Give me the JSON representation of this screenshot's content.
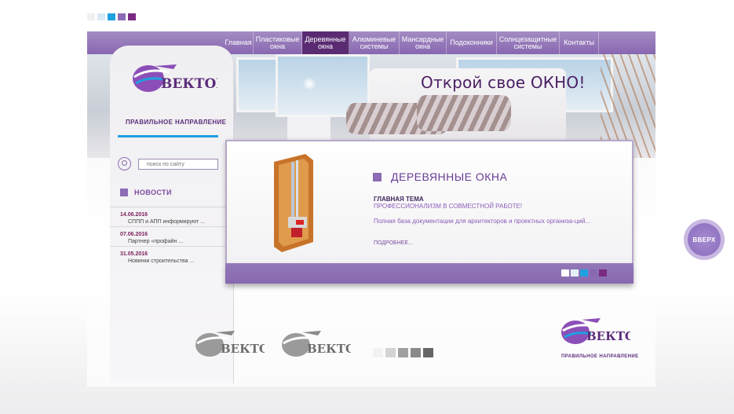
{
  "top_swatches": [
    "#f0f0f2",
    "#d8eaf6",
    "#1fa0e0",
    "#8c6cb4",
    "#7a2a80"
  ],
  "nav": {
    "items": [
      {
        "label": "Главная",
        "active": false,
        "width": 38
      },
      {
        "label": "Пластиковые\nокна",
        "active": false,
        "width": 62
      },
      {
        "label": "Деревянные\nокна",
        "active": true,
        "width": 60
      },
      {
        "label": "Алюминевые\nсистемы",
        "active": false,
        "width": 64
      },
      {
        "label": "Мансардные\nокна",
        "active": false,
        "width": 60
      },
      {
        "label": "Подоконники",
        "active": false,
        "width": 64
      },
      {
        "label": "Солнцезащитные\nсистемы",
        "active": false,
        "width": 80
      },
      {
        "label": "Контакты",
        "active": false,
        "width": 50
      }
    ]
  },
  "hero": {
    "slogan": "Открой свое ОКНО!"
  },
  "brand": {
    "name": "ВЕКТОР",
    "slogan": "ПРАВИЛЬНОЕ НАПРАВЛЕНИЕ"
  },
  "search": {
    "placeholder": "поиск по сайту"
  },
  "news": {
    "title": "НОВОСТИ",
    "items": [
      {
        "date": "14.06.2016",
        "text": "СППП и АПП информируют ..."
      },
      {
        "date": "07.06.2016",
        "text": "Партнер «профайн ..."
      },
      {
        "date": "31.05.2016",
        "text": "Новинки строительства ..."
      }
    ]
  },
  "panel": {
    "title": "ДЕРЕВЯННЫЕ ОКНА",
    "subtitle": "ГЛАВНАЯ ТЕМА",
    "subtitle2": "ПРОФЕССИОНАЛИЗМ В СОВМЕСТНОЙ РАБОТЕ!",
    "description": "Полная база документации для архитекторов и проектных организа-ций...",
    "more": "ПОДРОБНЕЕ...",
    "slider_dots": [
      "#ffffff",
      "#e4eef8",
      "#1fa0e0",
      "#8868b0",
      "#7a2a80"
    ]
  },
  "bottom_squares": [
    "#f2f2f2",
    "#d4d4d4",
    "#a0a0a0",
    "#8a8a8a",
    "#666666"
  ],
  "up_button": {
    "label": "ВВЕРХ"
  },
  "colors": {
    "accent": "#8c6cb4",
    "dark_purple": "#5a2b72",
    "blue": "#1fa0e0"
  }
}
